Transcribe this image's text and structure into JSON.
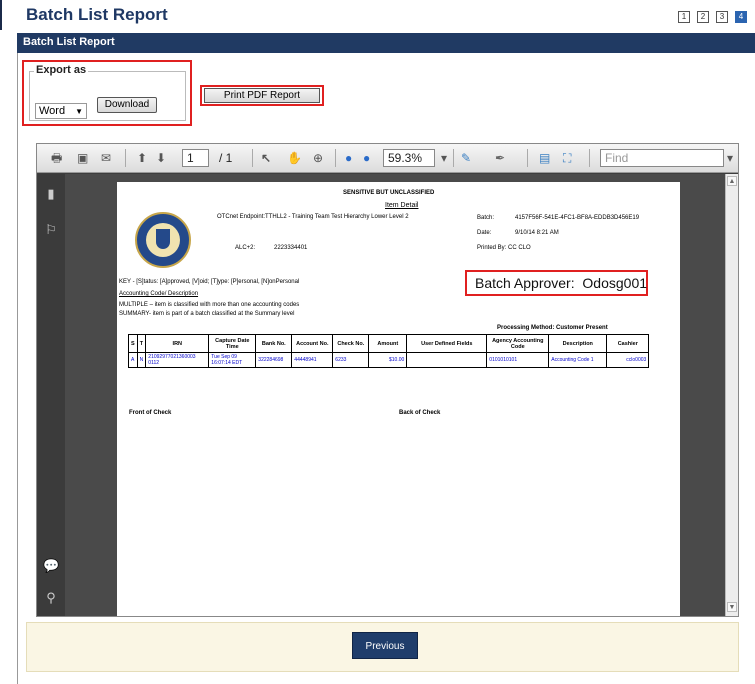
{
  "page": {
    "title": "Batch List Report",
    "steps": [
      "1",
      "2",
      "3",
      "4"
    ],
    "active_step": "4"
  },
  "section": {
    "header": "Batch List Report"
  },
  "export": {
    "legend": "Export as",
    "format_selected": "Word",
    "download_label": "Download"
  },
  "print": {
    "label": "Print PDF Report"
  },
  "viewer": {
    "page_current": "1",
    "page_total": "/ 1",
    "zoom": "59.3%",
    "find_placeholder": "Find",
    "toolbar_icons": [
      "print-icon",
      "save-icon",
      "email-icon",
      "prev-page-icon",
      "next-page-icon",
      "select-tool-icon",
      "hand-tool-icon",
      "marquee-zoom-icon",
      "zoom-out-icon",
      "zoom-in-icon",
      "comment-tool-icon",
      "sign-tool-icon",
      "save-copy-icon",
      "fit-page-icon"
    ],
    "rail_icons": [
      "pages-icon",
      "bookmarks-icon",
      "comments-icon",
      "attachments-icon"
    ]
  },
  "report": {
    "classification": "SENSITIVE BUT UNCLASSIFIED",
    "subtitle": "Item Detail",
    "endpoint": "OTCnet Endpoint:TTHLL2 - Training Team Test Hierarchy Lower Level 2",
    "alc_label": "ALC+2:",
    "alc_value": "2223334401",
    "batch_label": "Batch:",
    "batch_value": "4157F56F-541E-4FC1-BF8A-EDDB3D456E19",
    "date_label": "Date:",
    "date_value": "9/10/14 8:21 AM",
    "printed_by": "Printed By: CC CLO",
    "approver_label": "Batch Approver:",
    "approver_value": "Odosg001",
    "key_line": "KEY - [S]tatus: [A]pproved, [V]oid; [T]ype: [P]ersonal, [N]onPersonal",
    "accounting_heading": "Accounting Code/ Description",
    "multiple_line": "MULTIPLE – item is classified with more than one accounting codes",
    "summary_line": "SUMMARY- item is part of a batch classified at the Summary level",
    "processing_method": "Processing Method:  Customer Present",
    "front_check": "Front of Check",
    "back_check": "Back of Check",
    "columns": [
      "S",
      "T",
      "IRN",
      "Capture Date Time",
      "Bank No.",
      "Account No.",
      "Check No.",
      "Amount",
      "User Defined Fields",
      "Agency Accounting Code",
      "Description",
      "Cashier"
    ],
    "row": [
      "A",
      "N",
      "21092977021360003 0112",
      "Tue Sep 09 16:07:14 EDT",
      "322284698",
      "44448941",
      "6233",
      "$10.00",
      "",
      "0101010101",
      "Accounting Code 1",
      "cclo0003"
    ]
  },
  "footer": {
    "previous_label": "Previous"
  }
}
